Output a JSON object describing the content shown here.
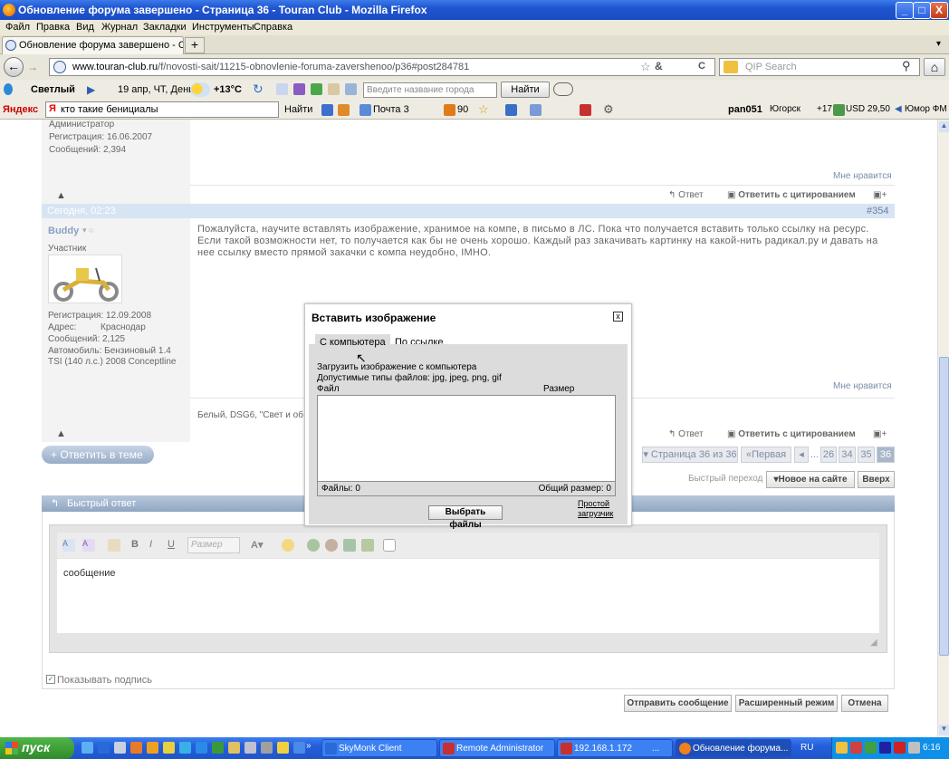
{
  "window": {
    "title": "Обновление форума завершено - Страница 36 - Touran Club - Mozilla Firefox",
    "min": "_",
    "max": "□",
    "close": "X"
  },
  "menu": [
    "Файл",
    "Правка",
    "Вид",
    "Журнал",
    "Закладки",
    "Инструменты",
    "Справка"
  ],
  "tab": {
    "label": "Обновление форума завершено - Страниц...",
    "close": "×",
    "new": "+",
    "list": "▾"
  },
  "nav": {
    "back": "←",
    "forward": "→",
    "url_domain": "www.touran-club.ru",
    "url_path": "/f/novosti-sait/11215-obnovlenie-foruma-zavershenoo/p36#post284781",
    "search_placeholder": "QIP Search",
    "home": "⌂",
    "reload": "C"
  },
  "weather": {
    "label": "Светлый",
    "date": "19 апр, ЧТ, День",
    "temp": "+13°C",
    "city_placeholder": "Введите название города",
    "find": "Найти"
  },
  "yandex": {
    "logo": "Яндекс",
    "query": "кто такие бенициалы",
    "find": "Найти",
    "mail": "Почта 3",
    "count": "90",
    "user": "pan051",
    "region": "Югорск",
    "temp": "+17",
    "usd": "USD 29,50",
    "radio": "Юмор ФМ"
  },
  "post1": {
    "role": "Администратор",
    "reg": "Регистрация:  16.06.2007",
    "msgs": "Сообщений:  2,394",
    "like": "Мне нравится",
    "reply": "Ответ",
    "quote": "Ответить с цитированием"
  },
  "post2": {
    "date": "Сегодня, 02:23",
    "num": "#354",
    "author": "Buddy",
    "role": "Участник",
    "reg_label": "Регистрация:",
    "reg": "12.09.2008",
    "addr_label": "Адрес:",
    "addr": "Краснодар",
    "msgs": "Сообщений:  2,125",
    "car": "Автомобиль:  Бензиновый 1.4 TSI (140 л.с.) 2008 Conceptline",
    "text": "Пожалуйста, научите вставлять изображение, хранимое на компе, в письмо в ЛС. Пока что получается вставить только ссылку на ресурс. Если такой возможности нет, то получается как бы не очень хорошо. Каждый раз закачивать картинку на какой-нить радикал.ру и давать на нее ссылку вместо прямой закачки с компа неудобно, IMHO.",
    "sig": "Белый, DSG6, \"Свет и об",
    "like": "Мне нравится",
    "reply": "Ответ",
    "quote": "Ответить с цитированием"
  },
  "paging": {
    "reply_thread": "+ Ответить в теме",
    "page_of": "▾ Страница 36 из 36",
    "first": "«Первая",
    "prev": "◂",
    "dots": "...",
    "pages": [
      "26",
      "34",
      "35",
      "36"
    ],
    "quick_nav": "Быстрый переход",
    "new": "▾Новое на сайте",
    "top": "Вверх"
  },
  "quick": {
    "title": "Быстрый ответ",
    "size_ph": "Размер",
    "placeholder": "сообщение",
    "show_sig": "Показывать подпись",
    "send": "Отправить сообщение",
    "advanced": "Расширенный режим",
    "cancel": "Отмена"
  },
  "modal": {
    "title": "Вставить изображение",
    "close": "x",
    "tab1": "С компьютера",
    "tab2": "По ссылке",
    "upload": "Загрузить изображение с компьютера",
    "types": "Допустимые типы файлов: jpg, jpeg, png, gif",
    "col_file": "Файл",
    "col_size": "Размер",
    "files": "Файлы: 0",
    "total": "Общий размер: 0",
    "choose": "Выбрать файлы",
    "simple": "Простой загрузчик"
  },
  "taskbar": {
    "start": "пуск",
    "tasks": [
      "SkyMonk Client",
      "Remote Administrator",
      "192.168.1.172",
      "Обновление форума..."
    ],
    "more": "...",
    "lang": "RU",
    "time": "6:16"
  }
}
